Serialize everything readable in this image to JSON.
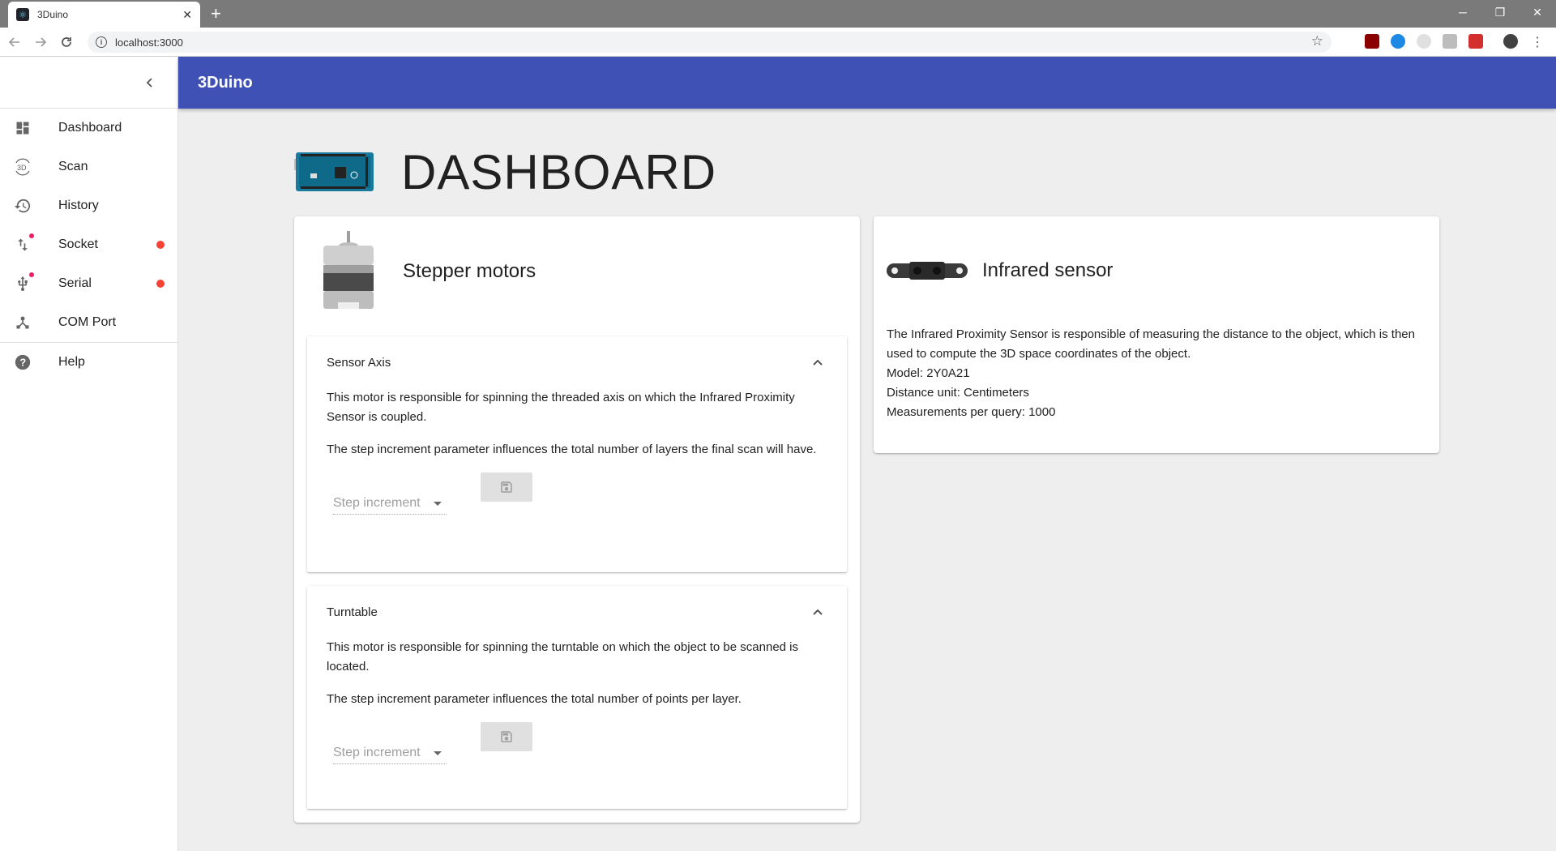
{
  "browser": {
    "tab_title": "3Duino",
    "tab_close": "✕",
    "new_tab": "+",
    "url": "localhost:3000",
    "win_min": "─",
    "win_restore": "❐",
    "win_close": "✕"
  },
  "app": {
    "title": "3Duino",
    "accent": "#3f51b5"
  },
  "sidebar": {
    "items": [
      {
        "label": "Dashboard",
        "icon": "dashboard-icon"
      },
      {
        "label": "Scan",
        "icon": "3d-rotation-icon"
      },
      {
        "label": "History",
        "icon": "history-icon"
      },
      {
        "label": "Socket",
        "icon": "swap-vert-icon",
        "status": "disconnected"
      },
      {
        "label": "Serial",
        "icon": "usb-icon",
        "status": "disconnected"
      },
      {
        "label": "COM Port",
        "icon": "device-hub-icon"
      },
      {
        "label": "Help",
        "icon": "help-icon"
      }
    ]
  },
  "page": {
    "title": "DASHBOARD"
  },
  "stepper": {
    "title": "Stepper motors",
    "panels": [
      {
        "title": "Sensor Axis",
        "p1": "This motor is responsible for spinning the threaded axis on which the Infrared Proximity Sensor is coupled.",
        "p2": "The step increment parameter influences the total number of layers the final scan will have.",
        "select_placeholder": "Step increment"
      },
      {
        "title": "Turntable",
        "p1": "This motor is responsible for spinning the turntable on which the object to be scanned is located.",
        "p2": "The step increment parameter influences the total number of points per layer.",
        "select_placeholder": "Step increment"
      }
    ]
  },
  "infrared": {
    "title": "Infrared sensor",
    "description": "The Infrared Proximity Sensor is responsible of measuring the distance to the object, which is then used to compute the 3D space coordinates of the object.",
    "model": "Model: 2Y0A21",
    "unit": "Distance unit: Centimeters",
    "measurements": "Measurements per query: 1000"
  }
}
